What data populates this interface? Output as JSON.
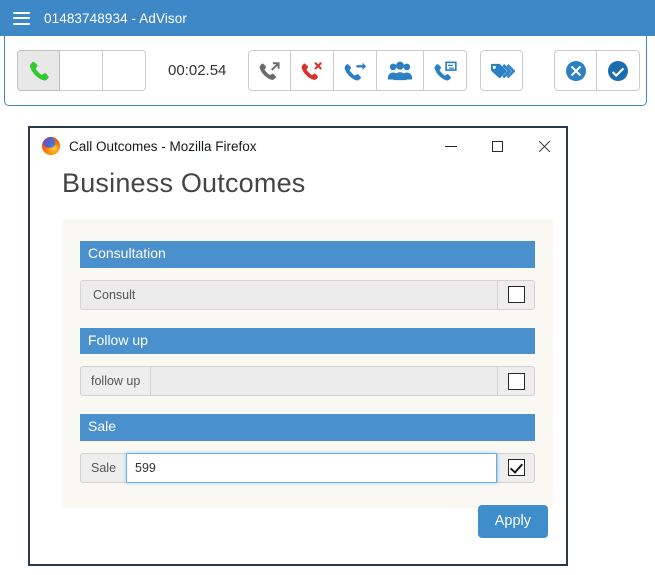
{
  "appbar": {
    "menu_icon": "hamburger-menu-icon",
    "title": "01483748934 - AdVisor",
    "background_color": "#3f88c8"
  },
  "toolbar": {
    "timer": "00:02.54",
    "call_controls": [
      {
        "name": "answer-call-button",
        "icon": "phone-handset-icon",
        "color": "#2ecc2e",
        "state": "active",
        "label": ""
      },
      {
        "name": "toolbar-blank-button-1",
        "icon": "",
        "color": "",
        "state": "default",
        "label": ""
      },
      {
        "name": "toolbar-blank-button-2",
        "icon": "",
        "color": "",
        "state": "default",
        "label": ""
      }
    ],
    "call_actions": [
      {
        "name": "outbound-call-button",
        "icon": "phone-outgoing-arrow-icon",
        "color": "#6b6b6b"
      },
      {
        "name": "hangup-call-button",
        "icon": "phone-hangup-x-icon",
        "color": "#d9342b"
      },
      {
        "name": "transfer-call-button",
        "icon": "phone-transfer-arrow-icon",
        "color": "#2b7fc4"
      },
      {
        "name": "conference-call-button",
        "icon": "people-group-icon",
        "color": "#2b7fc4"
      },
      {
        "name": "call-swap-button",
        "icon": "phone-swap-icon",
        "color": "#2b7fc4"
      }
    ],
    "tag_action": {
      "name": "tag-label-button",
      "icon": "tag-labels-icon",
      "color": "#2b7fc4"
    },
    "end_actions": [
      {
        "name": "reject-button",
        "icon": "circle-x-icon",
        "color": "#2b7fc4"
      },
      {
        "name": "accept-button",
        "icon": "circle-check-icon",
        "color": "#1c6cb0"
      }
    ]
  },
  "dialog": {
    "titlebar": {
      "app_icon": "firefox-logo-icon",
      "title": "Call Outcomes - Mozilla Firefox",
      "minimize_label": "minimize-icon",
      "maximize_label": "maximize-icon",
      "close_label": "close-icon"
    },
    "page_title": "Business Outcomes",
    "sections": [
      {
        "header": "Consultation",
        "row": {
          "type": "plain",
          "label": "Consult",
          "value": "",
          "placeholder": "",
          "checked": false,
          "focused": false
        }
      },
      {
        "header": "Follow up",
        "row": {
          "type": "input",
          "label": "follow up",
          "value": "",
          "placeholder": "",
          "checked": false,
          "focused": false
        }
      },
      {
        "header": "Sale",
        "row": {
          "type": "input",
          "label": "Sale",
          "value": "599",
          "placeholder": "",
          "checked": true,
          "focused": true
        }
      }
    ],
    "apply_label": "Apply",
    "accent_color": "#4a90cd",
    "card_background": "#faf8f2"
  }
}
